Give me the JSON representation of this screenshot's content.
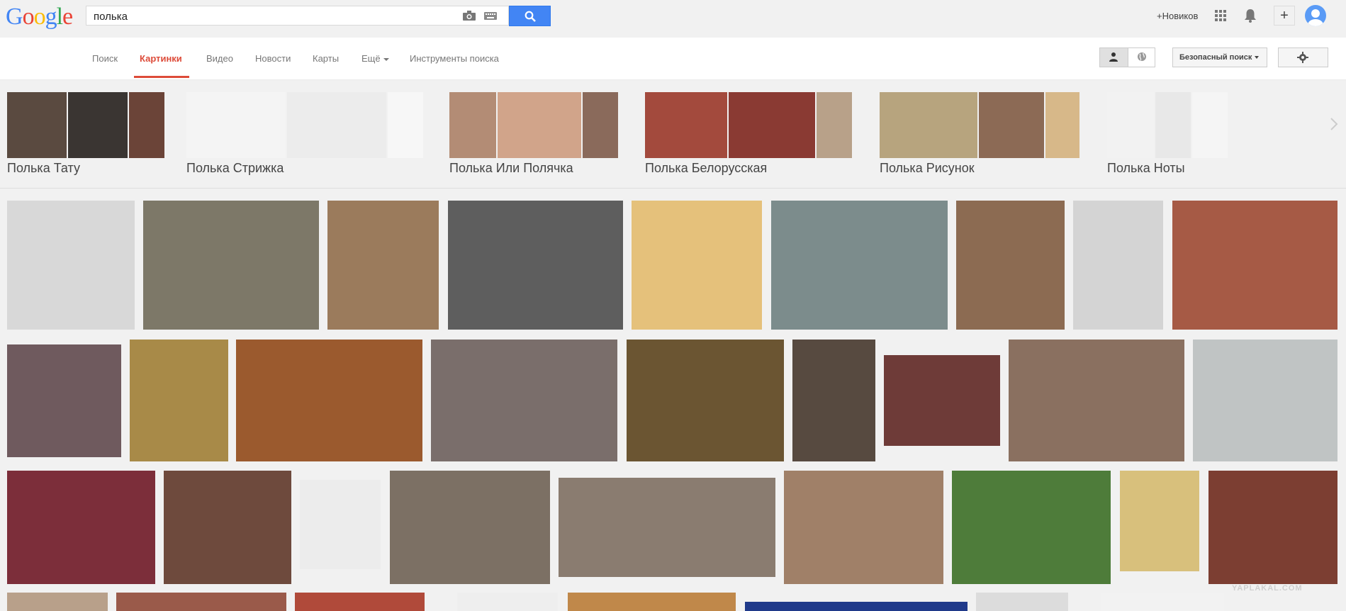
{
  "topbar": {
    "logo_letters": [
      {
        "ch": "G",
        "color": "#4285f4"
      },
      {
        "ch": "o",
        "color": "#ea4335"
      },
      {
        "ch": "o",
        "color": "#fbbc05"
      },
      {
        "ch": "g",
        "color": "#4285f4"
      },
      {
        "ch": "l",
        "color": "#34a853"
      },
      {
        "ch": "e",
        "color": "#ea4335"
      }
    ],
    "search_value": "полька",
    "user_link": "+Новиков",
    "share_label": "+"
  },
  "nav": {
    "tabs": [
      "Поиск",
      "Картинки",
      "Видео",
      "Новости",
      "Карты",
      "Ещё",
      "Инструменты поиска"
    ],
    "active_tab": "Картинки",
    "safe_search_label": "Безопасный поиск"
  },
  "related": [
    {
      "label": "Полька Тату",
      "colors": [
        "#5a4a40",
        "#3a3532",
        "#6b4438"
      ]
    },
    {
      "label": "Полька Стрижка",
      "colors": [
        "#f4f4f4",
        "#ececec",
        "#f7f7f7"
      ]
    },
    {
      "label": "Полька Или Полячка",
      "colors": [
        "#b38c75",
        "#d1a48a",
        "#8a6a5b"
      ]
    },
    {
      "label": "Полька Белорусская",
      "colors": [
        "#a34a3d",
        "#8a3a33",
        "#b8a189"
      ]
    },
    {
      "label": "Полька Рисунок",
      "colors": [
        "#b7a47e",
        "#8c6a55",
        "#d7b889"
      ]
    },
    {
      "label": "Полька Ноты",
      "colors": [
        "#f2f2f2",
        "#e8e8e8",
        "#f5f5f5"
      ]
    }
  ],
  "image_rows": [
    {
      "colors": [
        "#d8d8d8",
        "#7d7868",
        "#9b7b5c",
        "#5e5e5e",
        "#e5c17b",
        "#7c8c8c",
        "#8c6b52",
        "#d4d4d4",
        "#a65a45"
      ]
    },
    {
      "colors": [
        "#6f5a5e",
        "#a88a48",
        "#9b5a2e",
        "#7a6e6b",
        "#6b5532",
        "#574a40",
        "#6e3b38",
        "#8a7060",
        "#c0c4c4"
      ]
    },
    {
      "colors": [
        "#7c2e3a",
        "#6e4a3d",
        "#ececec",
        "#7c7064",
        "#8a7c70",
        "#a08068",
        "#4e7c3a",
        "#d8c07c",
        "#7c3e32"
      ]
    },
    {
      "colors": [
        "#b8a08a",
        "#9a5a4a",
        "#b04a3a",
        "#eeeeee",
        "#c0884a",
        "#203a8a",
        "#dcdcdc",
        "#f2f2f2"
      ]
    }
  ],
  "watermark": "YAPLAKAL.COM"
}
